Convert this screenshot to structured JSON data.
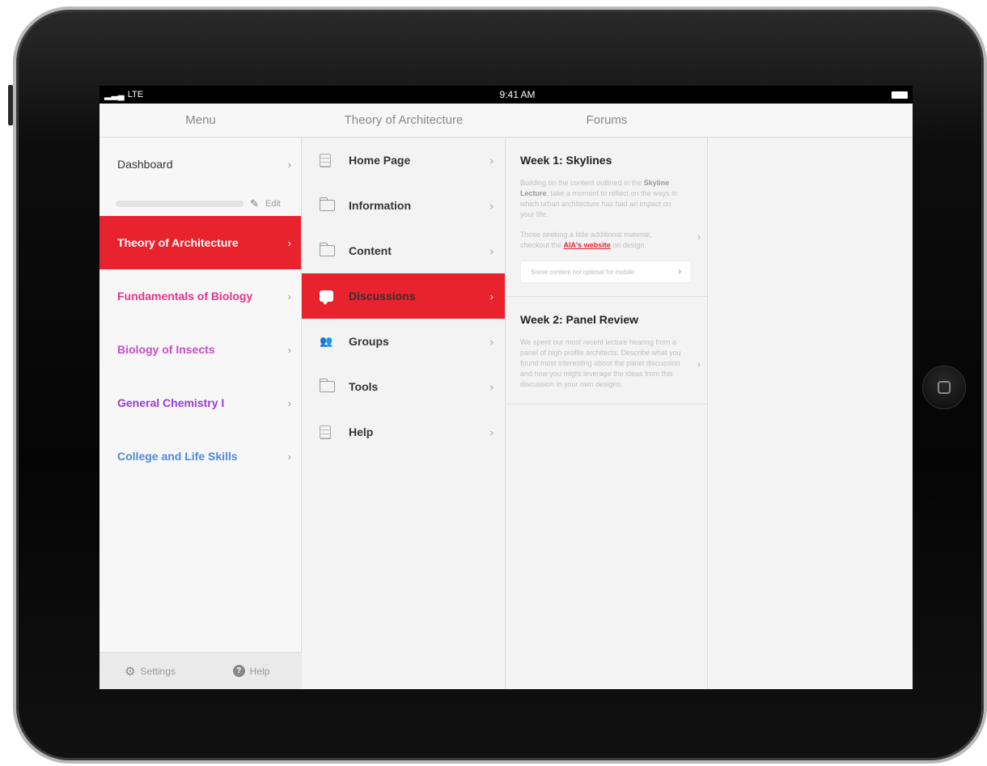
{
  "status_bar": {
    "carrier": "LTE",
    "time": "9:41 AM"
  },
  "headers": {
    "menu": "Menu",
    "course": "Theory of Architecture",
    "forums": "Forums"
  },
  "menu": {
    "dashboard": "Dashboard",
    "edit": "Edit",
    "courses": [
      {
        "label": "Theory of Architecture",
        "color": "#ffffff",
        "active": true
      },
      {
        "label": "Fundamentals of Biology",
        "color": "#e8338a"
      },
      {
        "label": "Biology of Insects",
        "color": "#c64fc9"
      },
      {
        "label": "General Chemistry I",
        "color": "#9b3bd6"
      },
      {
        "label": "College and Life Skills",
        "color": "#4f8ad8"
      }
    ],
    "footer": {
      "settings": "Settings",
      "help": "Help"
    }
  },
  "course_nav": [
    {
      "label": "Home Page",
      "icon": "document-icon"
    },
    {
      "label": "Information",
      "icon": "folder-icon"
    },
    {
      "label": "Content",
      "icon": "folder-icon"
    },
    {
      "label": "Discussions",
      "icon": "chat-icon",
      "active": true
    },
    {
      "label": "Groups",
      "icon": "groups-icon"
    },
    {
      "label": "Tools",
      "icon": "folder-icon"
    },
    {
      "label": "Help",
      "icon": "document-icon"
    }
  ],
  "forums": [
    {
      "title": "Week 1: Skylines",
      "p1_pre": "Building on the content outlined in the ",
      "p1_bold": "Skyline Lecture",
      "p1_post": ", take a moment to reflect on the ways in which urban architecture has had an impact on your life.",
      "p2_pre": "Those seeking a little additional material, checkout the ",
      "p2_link": "AIA's website",
      "p2_post": " on design.",
      "notice": "Some content not optimal for mobile"
    },
    {
      "title": "Week 2: Panel Review",
      "body": "We spent our most recent lecture hearing from a panel of high profile architects. Describe what you found most interesting about the panel discussion and how you might leverage the ideas from this discussion in your own designs."
    }
  ],
  "chevron": "›"
}
